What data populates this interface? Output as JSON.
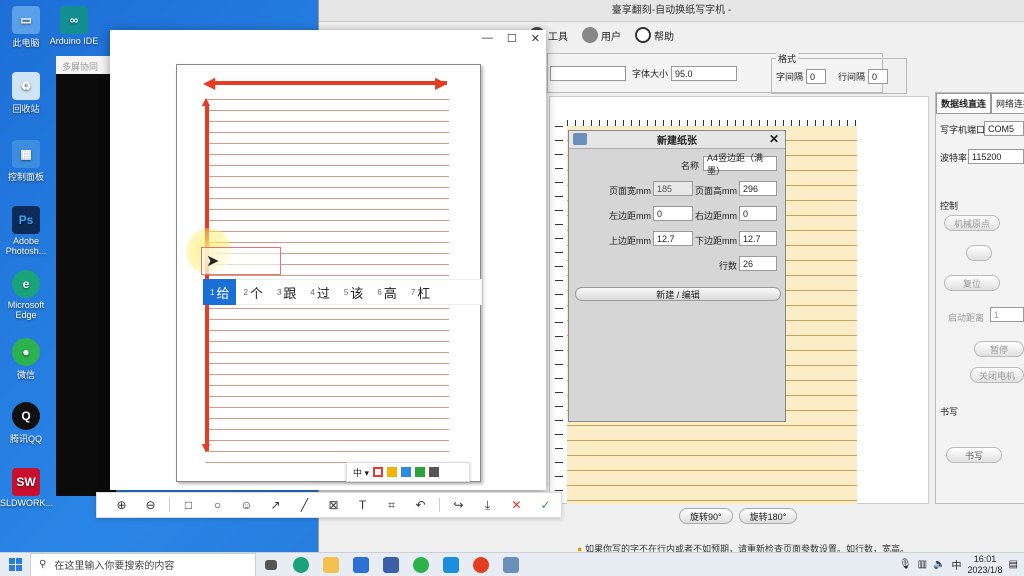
{
  "desktop": {
    "icons": [
      {
        "label": "此电脑",
        "color": "#5aa0e8"
      },
      {
        "label": "Arduino IDE",
        "color": "#138f92"
      },
      {
        "label": "回收站",
        "color": "#cfe4f7"
      },
      {
        "label": "控制面板",
        "color": "#3d8ee0"
      },
      {
        "label": "Adobe Photosh...",
        "color": "#0c2b57"
      },
      {
        "label": "Microsoft Edge",
        "color": "#1aa37a"
      },
      {
        "label": "微信",
        "color": "#2bb24c"
      },
      {
        "label": "腾讯QQ",
        "color": "#111111"
      },
      {
        "label": "SLDWORK...",
        "color": "#c8102e"
      }
    ]
  },
  "writer_app": {
    "title": "臺享翻刻-自动换纸写字机 -",
    "toolbar": [
      {
        "label": "工具"
      },
      {
        "label": "用户"
      },
      {
        "label": "帮助"
      }
    ],
    "font_size_label": "字体大小",
    "font_size_value": "95.0",
    "format_group": "格式",
    "char_spacing_label": "字间隔",
    "char_spacing_value": "0",
    "line_spacing_label": "行间隔",
    "line_spacing_value": "0",
    "rotate_90": "旋转90°",
    "rotate_180": "旋转180°",
    "hint": "如果你写的字不在行内或者不如预期，请重新检查页面参数设置。如行数，宽高。"
  },
  "right_panel": {
    "tab_serial": "数据线直连",
    "tab_network": "网络连接",
    "port_label": "写字机端口",
    "port_value": "COM5",
    "baud_label": "波特率",
    "baud_value": "115200",
    "control_label": "控制",
    "btn_origin": "机械原点",
    "btn_reset": "复位",
    "start_distance_label": "启动距离",
    "start_distance_value": "1",
    "btn_pause": "暂停",
    "btn_motor_off": "关闭电机",
    "write_label": "书写",
    "btn_write": "书写"
  },
  "dialog": {
    "title": "新建纸张",
    "name_label": "名称",
    "name_value": "A4竖边距（满墨）",
    "page_width_label": "页面宽mm",
    "page_width_value": "185",
    "page_height_label": "页面高mm",
    "page_height_value": "296",
    "left_margin_label": "左边距mm",
    "left_margin_value": "0",
    "right_margin_label": "右边距mm",
    "right_margin_value": "0",
    "top_margin_label": "上边距mm",
    "top_margin_value": "12.7",
    "bottom_margin_label": "下边距mm",
    "bottom_margin_value": "12.7",
    "rows_label": "行数",
    "rows_value": "26",
    "submit_label": "新建 / 编辑"
  },
  "back_window": {
    "header": "多屏协同"
  },
  "ime": {
    "candidates": [
      {
        "index": "1",
        "text": "给"
      },
      {
        "index": "2",
        "text": "个"
      },
      {
        "index": "3",
        "text": "跟"
      },
      {
        "index": "4",
        "text": "过"
      },
      {
        "index": "5",
        "text": "该"
      },
      {
        "index": "6",
        "text": "高"
      },
      {
        "index": "7",
        "text": "杠"
      }
    ]
  },
  "editor": {
    "stroke_size": "中",
    "colors": [
      "#e8392a",
      "#f5b400",
      "#2c8ae6",
      "#2aa33d",
      "#555555"
    ],
    "tools": [
      "放大",
      "缩小",
      "矩形",
      "椭圆",
      "表情",
      "箭头",
      "直线",
      "马赛克",
      "文本",
      "裁剪",
      "撤销",
      "分享",
      "下载",
      "取消",
      "完成"
    ]
  },
  "taskbar": {
    "search_placeholder": "在这里输入你要搜索的内容",
    "ime_indicator": "中",
    "time": "16:01",
    "date": "2023/1/8"
  }
}
